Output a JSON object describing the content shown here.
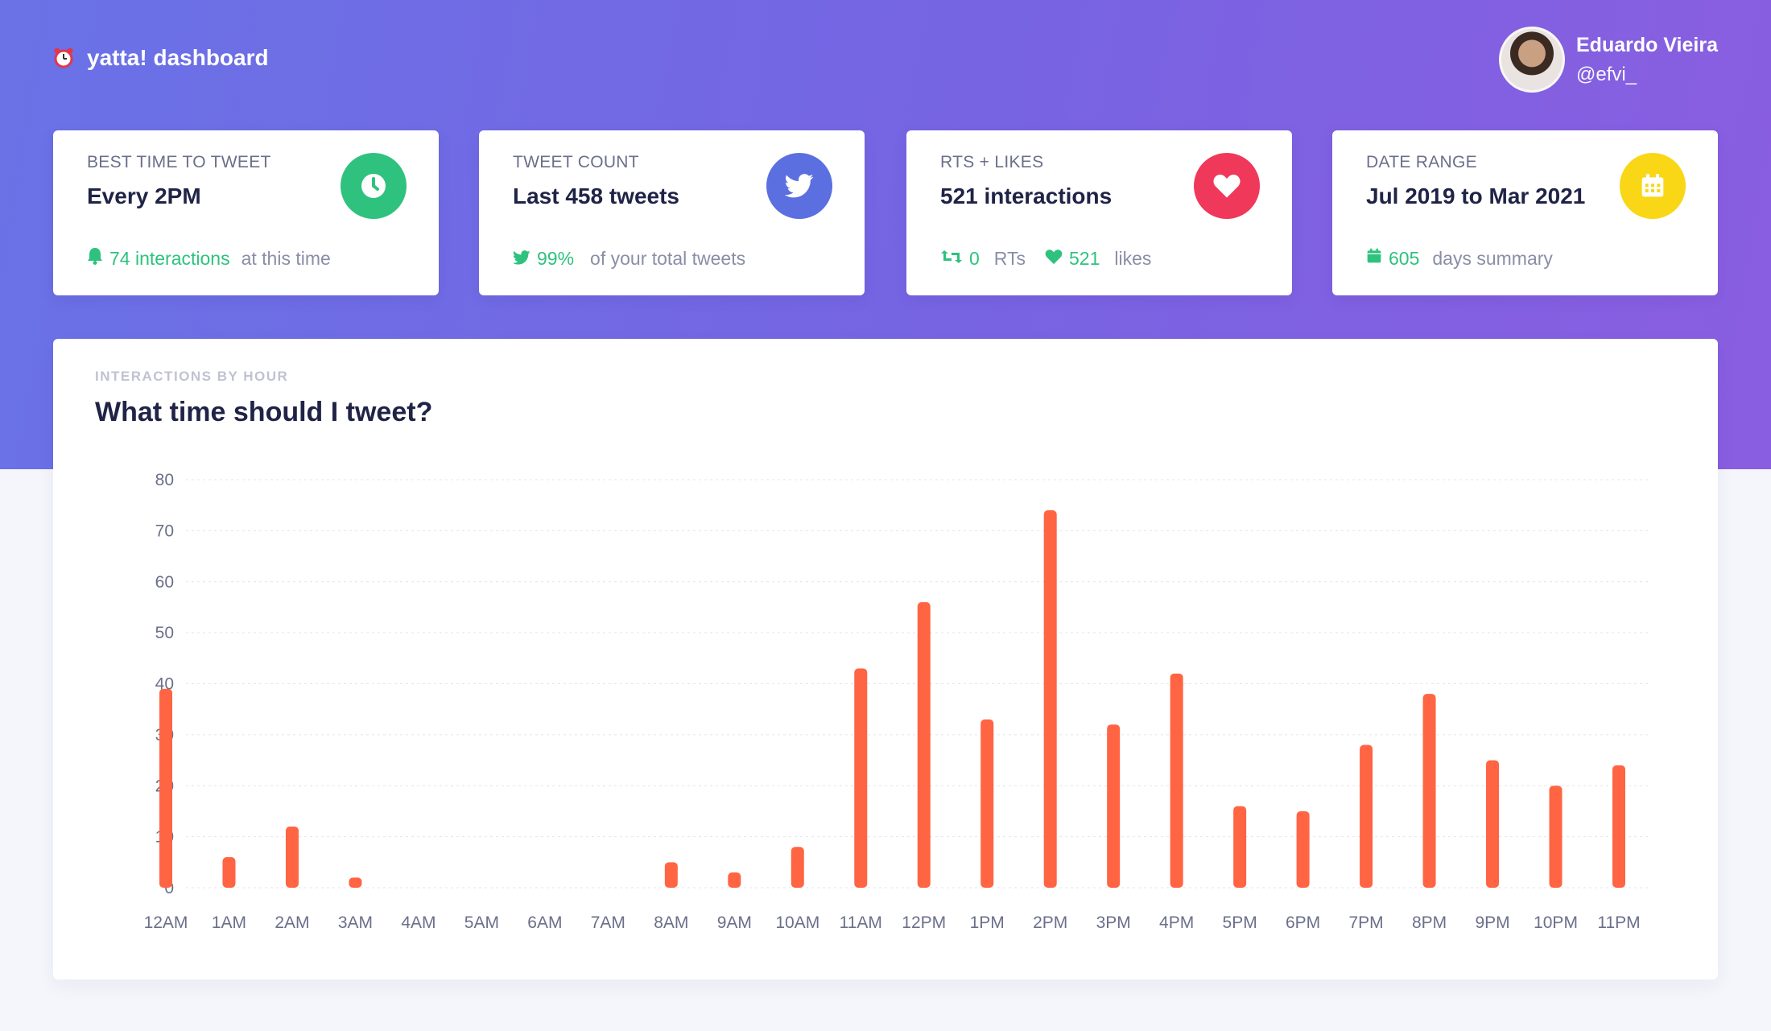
{
  "brand": {
    "title": "yatta! dashboard"
  },
  "user": {
    "name": "Eduardo Vieira",
    "handle": "@efvi_"
  },
  "cards": [
    {
      "label": "BEST TIME TO TWEET",
      "value": "Every 2PM",
      "foot_value": "74 interactions",
      "foot_text": "at this time",
      "color": "#2ec27e",
      "icon": "clock-icon"
    },
    {
      "label": "TWEET COUNT",
      "value": "Last 458 tweets",
      "foot_value": "99%",
      "foot_text": "of your total tweets",
      "color": "#5b6fe0",
      "icon": "twitter-icon"
    },
    {
      "label": "RTS + LIKES",
      "value": "521 interactions",
      "rt_value": "0",
      "rt_text": "RTs",
      "like_value": "521",
      "like_text": "likes",
      "color": "#f0385b",
      "icon": "heart-icon"
    },
    {
      "label": "DATE RANGE",
      "value": "Jul 2019 to Mar 2021",
      "foot_value": "605",
      "foot_text": "days summary",
      "color": "#f9d716",
      "icon": "calendar-icon"
    }
  ],
  "chart_card": {
    "kicker": "INTERACTIONS BY HOUR",
    "title": "What time should I tweet?"
  },
  "chart_data": {
    "type": "bar",
    "categories": [
      "12AM",
      "1AM",
      "2AM",
      "3AM",
      "4AM",
      "5AM",
      "6AM",
      "7AM",
      "8AM",
      "9AM",
      "10AM",
      "11AM",
      "12PM",
      "1PM",
      "2PM",
      "3PM",
      "4PM",
      "5PM",
      "6PM",
      "7PM",
      "8PM",
      "9PM",
      "10PM",
      "11PM"
    ],
    "values": [
      39,
      6,
      12,
      2,
      0,
      0,
      0,
      0,
      5,
      3,
      8,
      43,
      56,
      33,
      74,
      32,
      42,
      16,
      15,
      28,
      38,
      25,
      20,
      24
    ],
    "ylim": [
      0,
      80
    ],
    "yticks": [
      0,
      10,
      20,
      30,
      40,
      50,
      60,
      70,
      80
    ],
    "bar_color": "#ff6443",
    "grid": true
  }
}
